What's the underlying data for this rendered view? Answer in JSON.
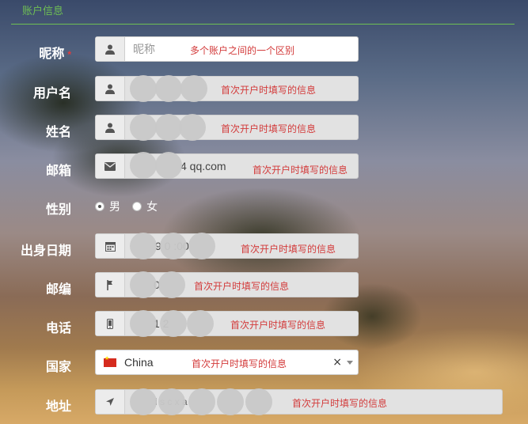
{
  "section": {
    "title": "账户信息"
  },
  "fields": {
    "nickname": {
      "label": "昵称",
      "required_mark": "*",
      "placeholder": "昵称",
      "hint": "多个账户之间的一个区别",
      "icon": "user-icon"
    },
    "username": {
      "label": "用户名",
      "hint": "首次开户时填写的信息",
      "icon": "user-icon"
    },
    "fullname": {
      "label": "姓名",
      "hint": "首次开户时填写的信息",
      "icon": "user-icon"
    },
    "email": {
      "label": "邮箱",
      "value_visible": "4 qq.com",
      "hint": "首次开户时填写的信息",
      "icon": "envelope-icon"
    },
    "gender": {
      "label": "性别",
      "options": [
        "男",
        "女"
      ],
      "selected": "男"
    },
    "birthdate": {
      "label": "出身日期",
      "value_visible": "9 0 :00",
      "hint": "首次开户时填写的信息",
      "icon": "calendar-icon"
    },
    "postcode": {
      "label": "邮编",
      "value_visible": "0",
      "hint": "首次开户时填写的信息",
      "icon": "flag-pin-icon"
    },
    "phone": {
      "label": "电话",
      "value_visible": "1 2",
      "hint": "首次开户时填写的信息",
      "icon": "mobile-icon"
    },
    "country": {
      "label": "国家",
      "value": "China",
      "hint": "首次开户时填写的信息",
      "icon": "china-flag-icon",
      "clear": "×"
    },
    "address": {
      "label": "地址",
      "value_visible": "i  s  c  x  a",
      "hint": "首次开户时填写的信息",
      "icon": "location-arrow-icon"
    }
  },
  "colors": {
    "accent": "#6fbf54",
    "hint": "#d33b3b",
    "required": "#e23b3b"
  }
}
